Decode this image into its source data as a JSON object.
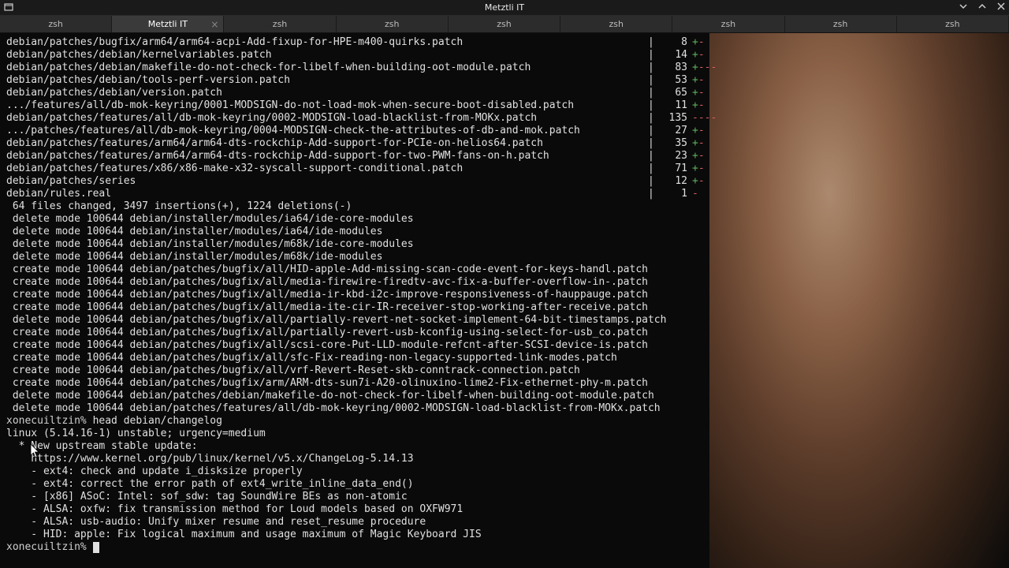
{
  "window": {
    "title": "Metztli IT"
  },
  "tabs": [
    {
      "label": "zsh",
      "active": false
    },
    {
      "label": "Metztli IT",
      "active": true,
      "closable": true
    },
    {
      "label": "zsh",
      "active": false
    },
    {
      "label": "zsh",
      "active": false
    },
    {
      "label": "zsh",
      "active": false
    },
    {
      "label": "zsh",
      "active": false
    },
    {
      "label": "zsh",
      "active": false
    },
    {
      "label": "zsh",
      "active": false
    },
    {
      "label": "zsh",
      "active": false
    }
  ],
  "diffstat": [
    {
      "path": "debian/patches/bugfix/arm64/arm64-acpi-Add-fixup-for-HPE-m400-quirks.patch",
      "num": "8",
      "plus": 1,
      "minus": 1
    },
    {
      "path": "debian/patches/debian/kernelvariables.patch",
      "num": "14",
      "plus": 1,
      "minus": 1
    },
    {
      "path": "debian/patches/debian/makefile-do-not-check-for-libelf-when-building-oot-module.patch",
      "num": "83",
      "plus": 1,
      "minus": 3
    },
    {
      "path": "debian/patches/debian/tools-perf-version.patch",
      "num": "53",
      "plus": 1,
      "minus": 1
    },
    {
      "path": "debian/patches/debian/version.patch",
      "num": "65",
      "plus": 1,
      "minus": 1
    },
    {
      "path": ".../features/all/db-mok-keyring/0001-MODSIGN-do-not-load-mok-when-secure-boot-disabled.patch",
      "num": "11",
      "plus": 1,
      "minus": 1
    },
    {
      "path": "debian/patches/features/all/db-mok-keyring/0002-MODSIGN-load-blacklist-from-MOKx.patch",
      "num": "135",
      "plus": 0,
      "minus": 4
    },
    {
      "path": ".../patches/features/all/db-mok-keyring/0004-MODSIGN-check-the-attributes-of-db-and-mok.patch",
      "num": "27",
      "plus": 1,
      "minus": 1
    },
    {
      "path": "debian/patches/features/arm64/arm64-dts-rockchip-Add-support-for-PCIe-on-helios64.patch",
      "num": "35",
      "plus": 1,
      "minus": 1
    },
    {
      "path": "debian/patches/features/arm64/arm64-dts-rockchip-Add-support-for-two-PWM-fans-on-h.patch",
      "num": "23",
      "plus": 1,
      "minus": 1
    },
    {
      "path": "debian/patches/features/x86/x86-make-x32-syscall-support-conditional.patch",
      "num": "71",
      "plus": 1,
      "minus": 1
    },
    {
      "path": "debian/patches/series",
      "num": "12",
      "plus": 1,
      "minus": 1
    },
    {
      "path": "debian/rules.real",
      "num": "1",
      "plus": 0,
      "minus": 1
    }
  ],
  "summary": " 64 files changed, 3497 insertions(+), 1224 deletions(-)",
  "modes": [
    " delete mode 100644 debian/installer/modules/ia64/ide-core-modules",
    " delete mode 100644 debian/installer/modules/ia64/ide-modules",
    " delete mode 100644 debian/installer/modules/m68k/ide-core-modules",
    " delete mode 100644 debian/installer/modules/m68k/ide-modules",
    " create mode 100644 debian/patches/bugfix/all/HID-apple-Add-missing-scan-code-event-for-keys-handl.patch",
    " create mode 100644 debian/patches/bugfix/all/media-firewire-firedtv-avc-fix-a-buffer-overflow-in-.patch",
    " create mode 100644 debian/patches/bugfix/all/media-ir-kbd-i2c-improve-responsiveness-of-hauppauge.patch",
    " create mode 100644 debian/patches/bugfix/all/media-ite-cir-IR-receiver-stop-working-after-receive.patch",
    " delete mode 100644 debian/patches/bugfix/all/partially-revert-net-socket-implement-64-bit-timestamps.patch",
    " create mode 100644 debian/patches/bugfix/all/partially-revert-usb-kconfig-using-select-for-usb_co.patch",
    " create mode 100644 debian/patches/bugfix/all/scsi-core-Put-LLD-module-refcnt-after-SCSI-device-is.patch",
    " create mode 100644 debian/patches/bugfix/all/sfc-Fix-reading-non-legacy-supported-link-modes.patch",
    " create mode 100644 debian/patches/bugfix/all/vrf-Revert-Reset-skb-conntrack-connection.patch",
    " create mode 100644 debian/patches/bugfix/arm/ARM-dts-sun7i-A20-olinuxino-lime2-Fix-ethernet-phy-m.patch",
    " delete mode 100644 debian/patches/debian/makefile-do-not-check-for-libelf-when-building-oot-module.patch",
    " delete mode 100644 debian/patches/features/all/db-mok-keyring/0002-MODSIGN-load-blacklist-from-MOKx.patch"
  ],
  "prompt1": {
    "host": "xonecuiltzin%",
    "cmd": " head debian/changelog"
  },
  "changelog": [
    "linux (5.14.16-1) unstable; urgency=medium",
    "",
    "  * New upstream stable update:",
    "    https://www.kernel.org/pub/linux/kernel/v5.x/ChangeLog-5.14.13",
    "    - ext4: check and update i_disksize properly",
    "    - ext4: correct the error path of ext4_write_inline_data_end()",
    "    - [x86] ASoC: Intel: sof_sdw: tag SoundWire BEs as non-atomic",
    "    - ALSA: oxfw: fix transmission method for Loud models based on OXFW971",
    "    - ALSA: usb-audio: Unify mixer resume and reset_resume procedure",
    "    - HID: apple: Fix logical maximum and usage maximum of Magic Keyboard JIS"
  ],
  "prompt2": {
    "host": "xonecuiltzin%",
    "cmd": " "
  }
}
